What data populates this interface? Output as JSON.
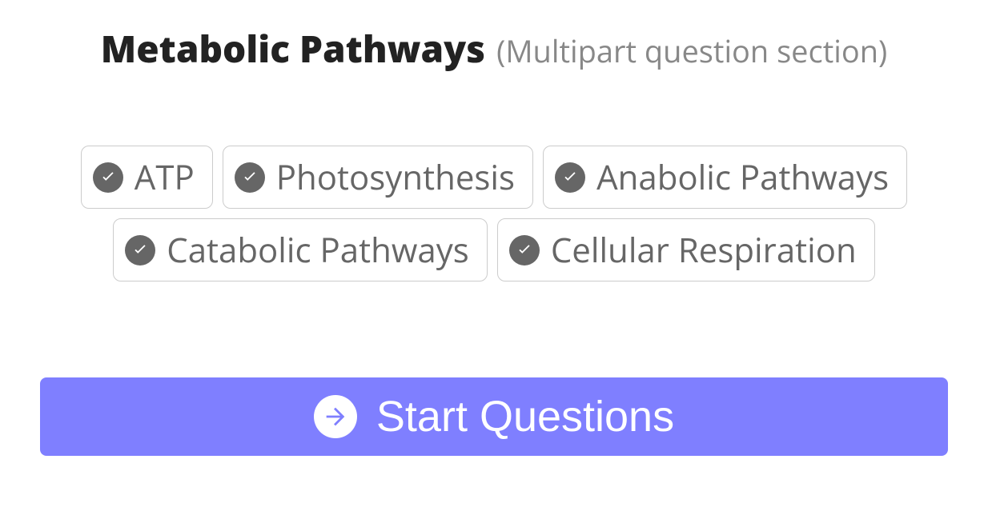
{
  "header": {
    "title": "Metabolic Pathways",
    "subtitle": "(Multipart question section)"
  },
  "chips": [
    {
      "label": "ATP"
    },
    {
      "label": "Photosynthesis"
    },
    {
      "label": "Anabolic Pathways"
    },
    {
      "label": "Catabolic Pathways"
    },
    {
      "label": "Cellular Respiration"
    }
  ],
  "start_button": {
    "label": "Start Questions"
  }
}
